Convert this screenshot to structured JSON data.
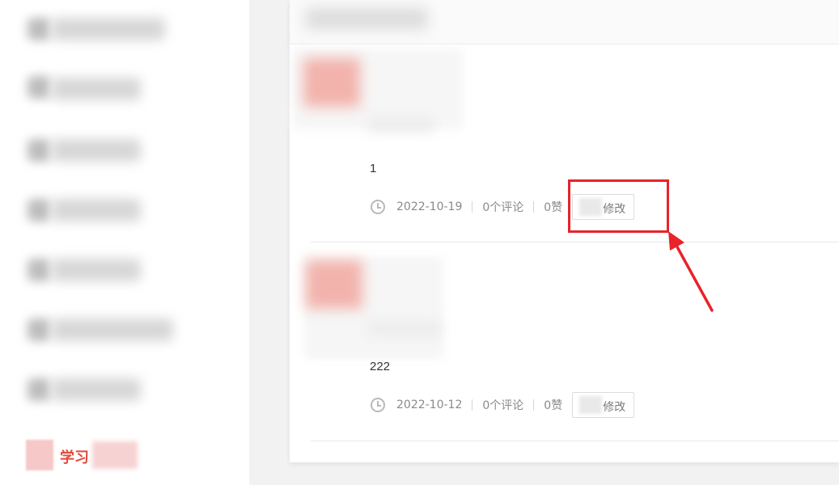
{
  "sidebar": {
    "active_item": {
      "label": "学习"
    },
    "items": [
      {
        "name": "item-1"
      },
      {
        "name": "item-2"
      },
      {
        "name": "item-3"
      },
      {
        "name": "item-4"
      },
      {
        "name": "item-5"
      },
      {
        "name": "item-6"
      },
      {
        "name": "item-7"
      }
    ]
  },
  "posts": [
    {
      "content": "1",
      "date": "2022-10-19",
      "comments": "0个评论",
      "likes": "0赞",
      "edit_label": "修改"
    },
    {
      "content": "222",
      "date": "2022-10-12",
      "comments": "0个评论",
      "likes": "0赞",
      "edit_label": "修改"
    }
  ],
  "annotation": {
    "color": "#e8232a",
    "icons": [
      "clock-icon",
      "arrow-icon"
    ]
  }
}
